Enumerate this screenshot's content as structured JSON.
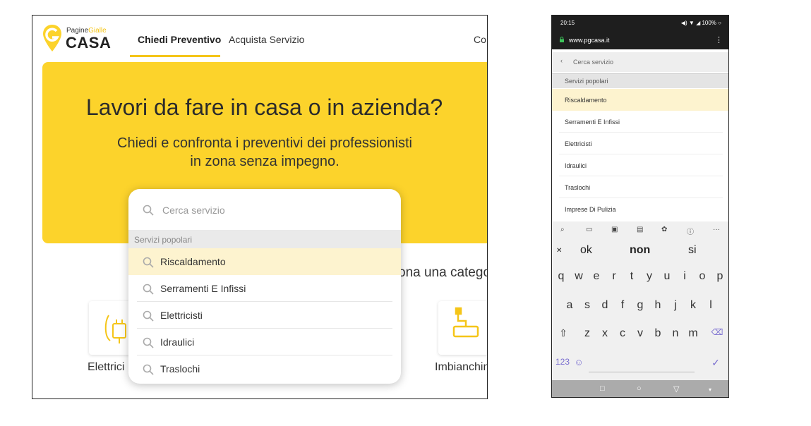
{
  "desktop": {
    "logo": {
      "top_a": "Pagine",
      "top_b": "Gialle",
      "main": "CASA"
    },
    "nav": {
      "active": "Chiedi Preventivo",
      "second": "Acquista Servizio",
      "third": "Co"
    },
    "hero": {
      "title": "Lavori da fare in casa o in azienda?",
      "subtitle": "Chiedi e confronta i preventivi dei professionisti in zona senza impegno."
    },
    "category_prompt": "ona una catego",
    "cards": [
      {
        "label": "Elettrici"
      },
      {
        "label": "Imbianchin"
      }
    ],
    "dropdown": {
      "placeholder": "Cerca servizio",
      "section": "Servizi popolari",
      "items": [
        "Riscaldamento",
        "Serramenti E Infissi",
        "Elettricisti",
        "Idraulici",
        "Traslochi"
      ]
    },
    "colors": {
      "accent": "#fcd32b",
      "highlight": "#fdf3cf"
    }
  },
  "phone": {
    "status": {
      "time": "20:15",
      "battery": "100%"
    },
    "url": "www.pgcasa.it",
    "search_placeholder": "Cerca servizio",
    "section": "Servizi popolari",
    "items": [
      "Riscaldamento",
      "Serramenti E Infissi",
      "Elettricisti",
      "Idraulici",
      "Traslochi",
      "Imprese Di Pulizia"
    ],
    "keyboard": {
      "suggestions": [
        "ok",
        "non",
        "si"
      ],
      "row1": [
        "q",
        "w",
        "e",
        "r",
        "t",
        "y",
        "u",
        "i",
        "o",
        "p"
      ],
      "row2": [
        "a",
        "s",
        "d",
        "f",
        "g",
        "h",
        "j",
        "k",
        "l"
      ],
      "row3": [
        "z",
        "x",
        "c",
        "v",
        "b",
        "n",
        "m"
      ],
      "numbers_key": "123",
      "tools_more": "···"
    }
  }
}
